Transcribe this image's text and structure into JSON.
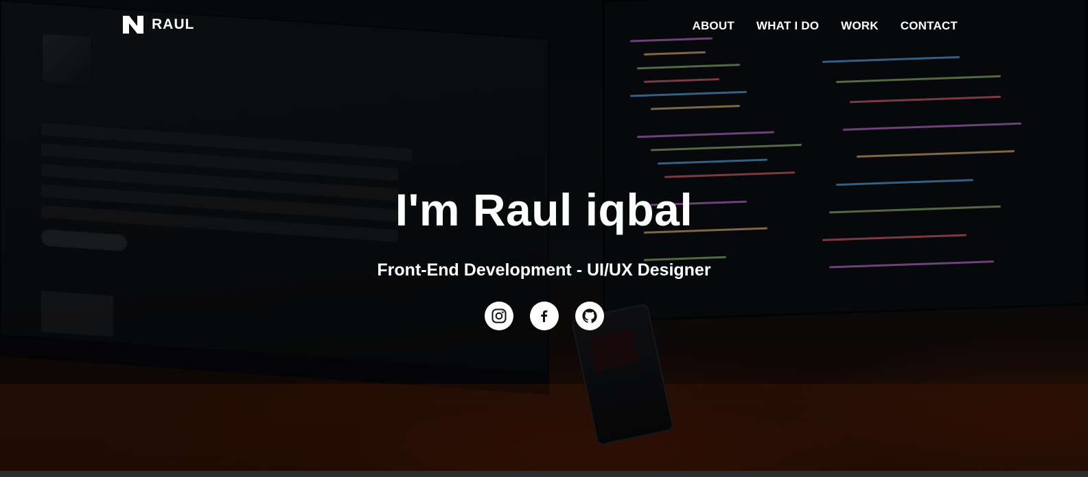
{
  "nav": {
    "logo_text": "RAUL",
    "items": [
      {
        "label": "ABOUT"
      },
      {
        "label": "WHAT I DO"
      },
      {
        "label": "WORK"
      },
      {
        "label": "CONTACT"
      }
    ]
  },
  "hero": {
    "title": "I'm Raul iqbal",
    "subtitle": "Front-End Development - UI/UX Designer"
  },
  "socials": [
    {
      "icon": "instagram-icon"
    },
    {
      "icon": "facebook-icon"
    },
    {
      "icon": "github-icon"
    }
  ],
  "colors": {
    "text": "#ffffff",
    "social_bg": "#ffffff",
    "social_icon": "#111111"
  }
}
